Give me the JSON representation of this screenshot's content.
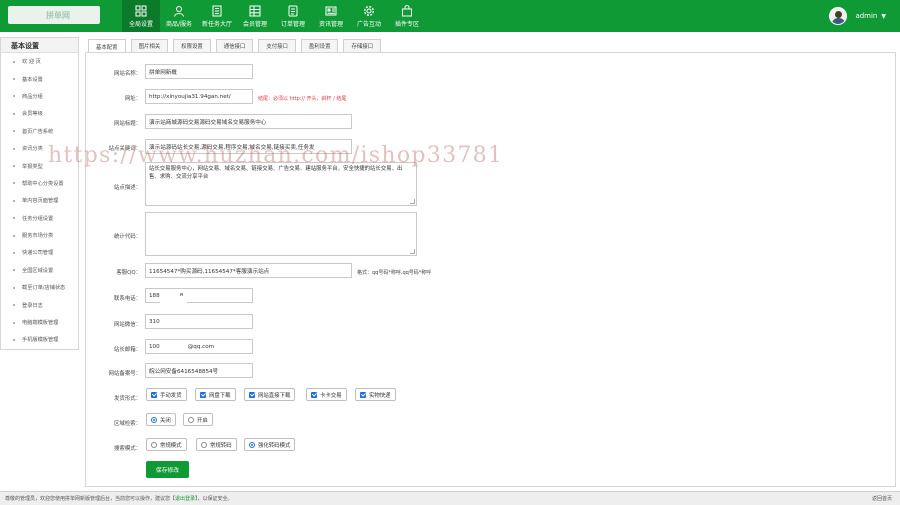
{
  "header": {
    "nav": [
      {
        "label": "全局设置",
        "icon": "grid-icon"
      },
      {
        "label": "商品/服务",
        "icon": "user-icon"
      },
      {
        "label": "新任务大厅",
        "icon": "building-icon"
      },
      {
        "label": "会员管理",
        "icon": "table-icon"
      },
      {
        "label": "订单管理",
        "icon": "list-icon"
      },
      {
        "label": "资讯管理",
        "icon": "document-icon"
      },
      {
        "label": "广告互动",
        "icon": "gear-icon"
      },
      {
        "label": "插件专区",
        "icon": "bag-icon"
      }
    ],
    "username": "admin",
    "caret": "▼"
  },
  "sidebar": {
    "title": "基本设置",
    "items": [
      {
        "label": "欢 迎 页"
      },
      {
        "label": "基本设置"
      },
      {
        "label": "商品分组"
      },
      {
        "label": "会员等级"
      },
      {
        "label": "首页广告系统"
      },
      {
        "label": "资讯分类"
      },
      {
        "label": "举报类型"
      },
      {
        "label": "帮助中心分类设置"
      },
      {
        "label": "单内容页面管理"
      },
      {
        "label": "任务分组设置"
      },
      {
        "label": "服务市场分类"
      },
      {
        "label": "快递公司管理"
      },
      {
        "label": "全国区域设置"
      },
      {
        "label": "截至订单/店铺状态"
      },
      {
        "label": "登录日志"
      },
      {
        "label": "电脑端模板管理"
      },
      {
        "label": "手机版模板管理"
      }
    ]
  },
  "tabs": [
    {
      "label": "基本配置"
    },
    {
      "label": "图片相关"
    },
    {
      "label": "权限设置"
    },
    {
      "label": "通信接口"
    },
    {
      "label": "支付接口"
    },
    {
      "label": "盈利设置"
    },
    {
      "label": "存储接口"
    }
  ],
  "form": {
    "site_name": {
      "label": "网站名称：",
      "value": "拼单网新概"
    },
    "site_url": {
      "label": "网址：",
      "value": "http://xinyoujia31.94gan.net/",
      "hint": "结尾：必须以 http:// 开头，斜杆 / 结尾",
      "hint_color": "#e03a3a"
    },
    "site_title": {
      "label": "网站标题：",
      "value": "演示站商城源码交易源码交易域名交易服务中心"
    },
    "keywords": {
      "label": "站点关键词：",
      "value": "演示站源码站长交易,源码交易,程序交易,域名交易,链接买卖,任务发"
    },
    "description": {
      "label": "站点描述：",
      "value": "站长交易服务中心，网站交易、域名交易、链接交易、广告交易、建站服务平台，安全快捷的站长交易、出售、求购、交流分享平台"
    },
    "stats_code": {
      "label": "统计代码：",
      "value": ""
    },
    "qq": {
      "label": "客服QQ：",
      "value": "11654547*购买源码,11654547*客服演示站点",
      "hint": "格式：qq号码*称呼,qq号码*称呼",
      "hint_color": "#444444"
    },
    "phone": {
      "label": "联系电话：",
      "value": "188"
    },
    "wechat": {
      "label": "网站微信：",
      "value": "310"
    },
    "email": {
      "label": "站长邮箱：",
      "value_prefix": "100",
      "value_suffix": "@qq.com"
    },
    "icp": {
      "label": "网站备案号：",
      "value": "皖公网安备6416548854号"
    },
    "delivery": {
      "label": "发货形式：",
      "options": [
        {
          "label": "手动发货",
          "checked": true
        },
        {
          "label": "网盘下载",
          "checked": true
        },
        {
          "label": "网站直接下载",
          "checked": true
        },
        {
          "label": "卡卡交易",
          "checked": true
        },
        {
          "label": "实物快递",
          "checked": true
        }
      ]
    },
    "region_filter": {
      "label": "区域检索：",
      "options": [
        {
          "label": "关闭",
          "selected": true
        },
        {
          "label": "开启",
          "selected": false
        }
      ]
    },
    "search_mode": {
      "label": "搜索模式：",
      "options": [
        {
          "label": "常规模式",
          "selected": false
        },
        {
          "label": "常规转码",
          "selected": false
        },
        {
          "label": "强化转码模式",
          "selected": true
        }
      ]
    },
    "save_label": "保存修改"
  },
  "statusbar": {
    "text_a": "尊敬的管理员，欢迎您使用拼单网新版管理后台，当前您可以操作，建议您【",
    "link": "退出登录",
    "text_b": "】，以保证安全。",
    "right": "返回首页"
  },
  "watermark": "https://www.huzhan.com/ishop33781",
  "colors": {
    "brand": "#109a36",
    "brand_dark": "#0b7a2a",
    "checkbox": "#1a6ee0"
  }
}
